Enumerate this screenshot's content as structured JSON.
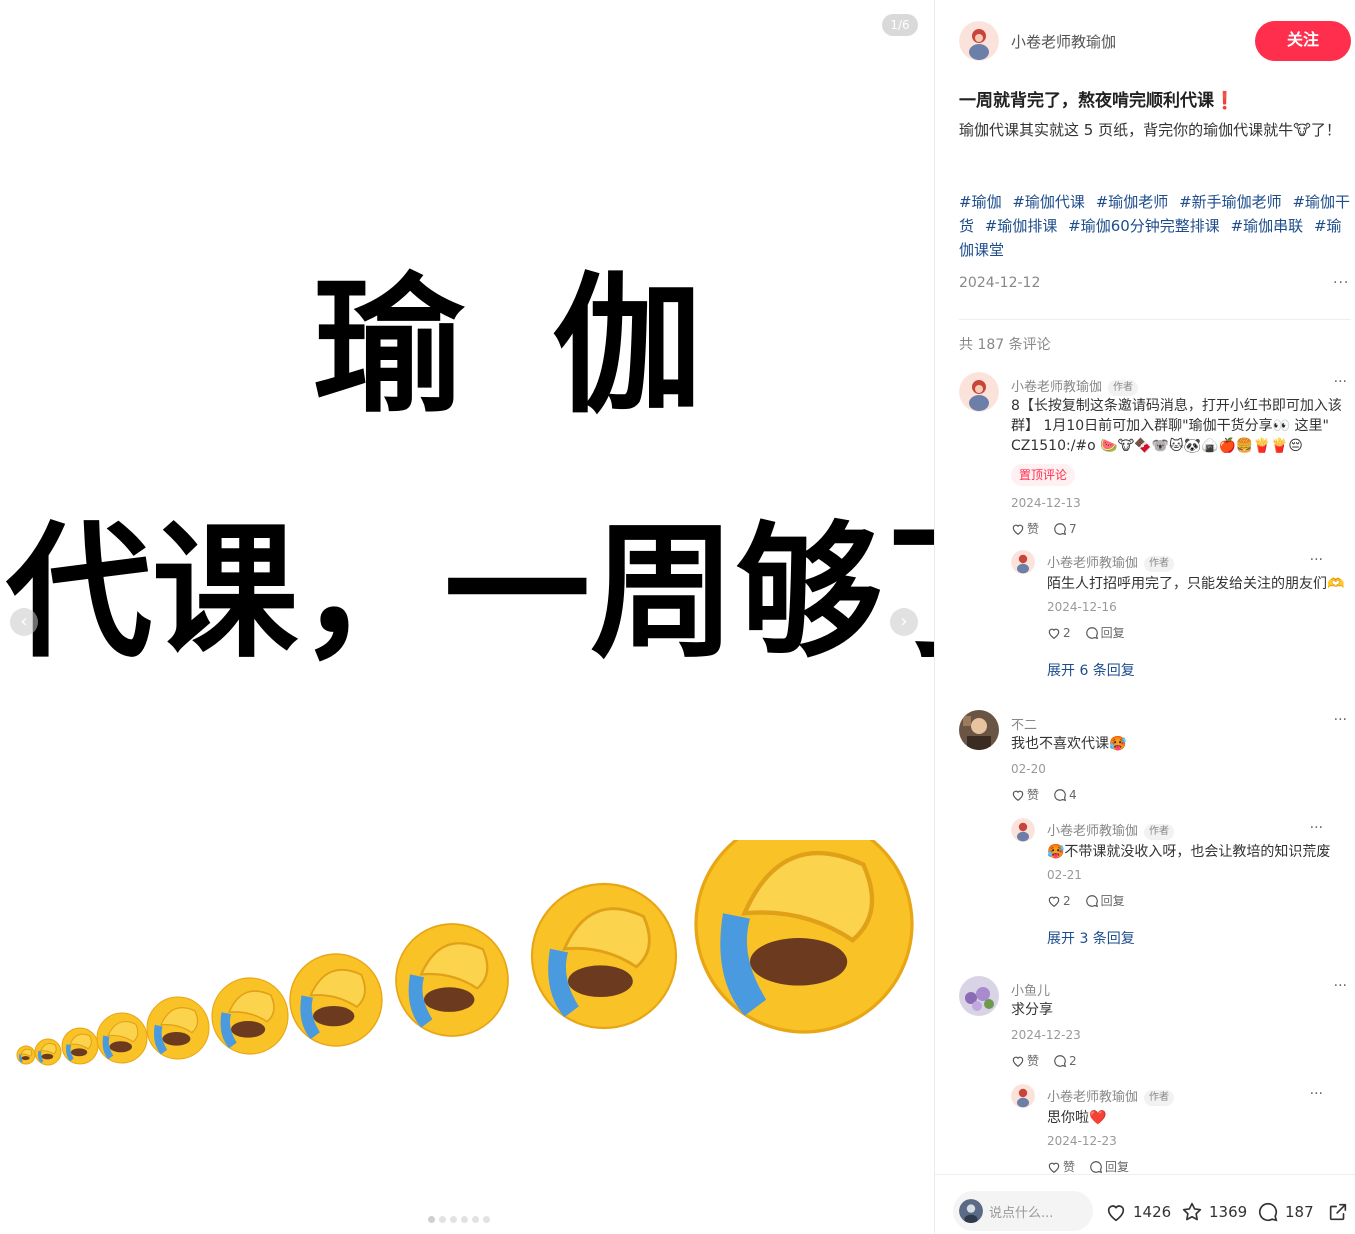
{
  "media": {
    "page_counter": "1/6",
    "title_line1": "瑜 伽",
    "title_line2": "代课，一周够了"
  },
  "author": {
    "name": "小卷老师教瑜伽",
    "follow_label": "关注"
  },
  "post": {
    "title": "一周就背完了，熬夜啃完顺利代课",
    "title_mark": "❗",
    "body": "瑜伽代课其实就这 5 页纸，背完你的瑜伽代课就牛🐮了！",
    "tags": [
      "#瑜伽",
      "#瑜伽代课",
      "#瑜伽老师",
      "#新手瑜伽老师",
      "#瑜伽干货",
      "#瑜伽排课",
      "#瑜伽60分钟完整排课",
      "#瑜伽串联",
      "#瑜伽课堂"
    ],
    "date": "2024-12-12",
    "comment_count": "共 187 条评论"
  },
  "comments": [
    {
      "name": "小卷老师教瑜伽",
      "badge": "作者",
      "text": "8【长按复制这条邀请码消息，打开小红书即可加入该群】 1月10日前可加入群聊\"瑜伽干货分享👀 这里\" CZ1510:/#o 🍉🐮🍫🐨🐱🐼🍙🍎🍔🍟🍟😔",
      "pinned": "置顶评论",
      "date": "2024-12-13",
      "like": "赞",
      "replies": "7",
      "reply": {
        "name": "小卷老师教瑜伽",
        "badge": "作者",
        "text": "陌生人打招呼用完了，只能发给关注的朋友们🫶",
        "date": "2024-12-16",
        "like": "2",
        "reply_label": "回复"
      },
      "expand": "展开 6 条回复"
    },
    {
      "name": "不二",
      "text": "我也不喜欢代课🥵",
      "date": "02-20",
      "like": "赞",
      "replies": "4",
      "reply": {
        "name": "小卷老师教瑜伽",
        "badge": "作者",
        "text": "🥵不带课就没收入呀，也会让教培的知识荒废",
        "date": "02-21",
        "like": "2",
        "reply_label": "回复"
      },
      "expand": "展开 3 条回复"
    },
    {
      "name": "小鱼儿",
      "text": "求分享",
      "date": "2024-12-23",
      "like": "赞",
      "replies": "2",
      "reply": {
        "name": "小卷老师教瑜伽",
        "badge": "作者",
        "text": "思你啦❤️",
        "date": "2024-12-23",
        "like": "赞",
        "reply_label": "回复"
      }
    }
  ],
  "bottom_bar": {
    "placeholder": "说点什么...",
    "likes": "1426",
    "collects": "1369",
    "comments": "187"
  },
  "colors": {
    "accent": "#ff2e4d",
    "tag_link": "#1e4d8c",
    "emoji_yellow": "#f9c226"
  },
  "icons": [
    "heart-icon",
    "star-icon",
    "comment-icon",
    "share-icon",
    "chevron-left-icon",
    "chevron-right-icon",
    "more-icon"
  ]
}
